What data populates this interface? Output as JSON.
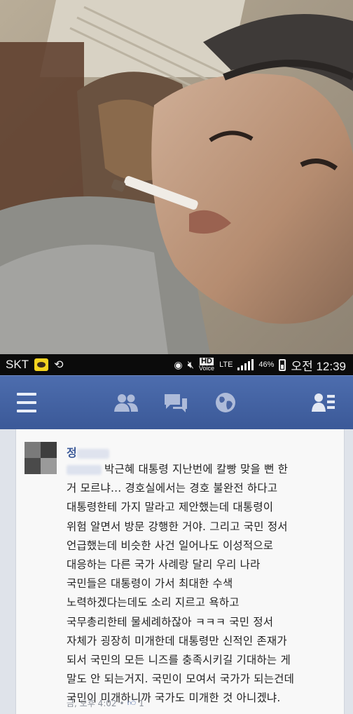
{
  "status_bar": {
    "carrier": "SKT",
    "hd_label": "HD",
    "voice_label": "Voice",
    "lte_label": "LTE",
    "battery": "46%",
    "time": "오전 12:39",
    "icons": [
      "kakaotalk-icon",
      "refresh-icon",
      "eye-icon",
      "mute-icon",
      "signal-icon",
      "battery-icon"
    ]
  },
  "nav": {
    "icons": [
      "menu-icon",
      "friend-requests-icon",
      "messages-icon",
      "notifications-globe-icon",
      "contacts-icon"
    ],
    "bg_color": "#3b5998"
  },
  "post": {
    "author": "정",
    "lines": [
      "박근혜 대통령 지난번에 칼빵 맞을 뻔 한",
      "거 모르냐... 경호실에서는 경호 불완전 하다고",
      "대통령한테 가지 말라고 제안했는데 대통령이",
      "위험 알면서 방문 강행한 거야. 그리고 국민 정서",
      "언급했는데 비슷한 사건 일어나도 이성적으로",
      "대응하는 다른 국가 사례랑 달리 우리 나라",
      "국민들은 대통령이 가서 최대한 수색",
      "노력하겠다는데도 소리 지르고 욕하고",
      "국무총리한테 물세례하잖아 ㅋㅋㅋ 국민 정서",
      "자체가 굉장히 미개한데 대통령만 신적인 존재가",
      "되서 국민의 모든 니즈를 충족시키길 기대하는 게",
      "말도 안 되는거지. 국민이 모여서 국가가 되는건데",
      "국민이 미개하니까 국가도 미개한 것 아니겠냐."
    ],
    "meta_time": "금, 오후 4:02",
    "meta_sep": "•",
    "like_count": "1",
    "link_color": "#3b5998"
  }
}
